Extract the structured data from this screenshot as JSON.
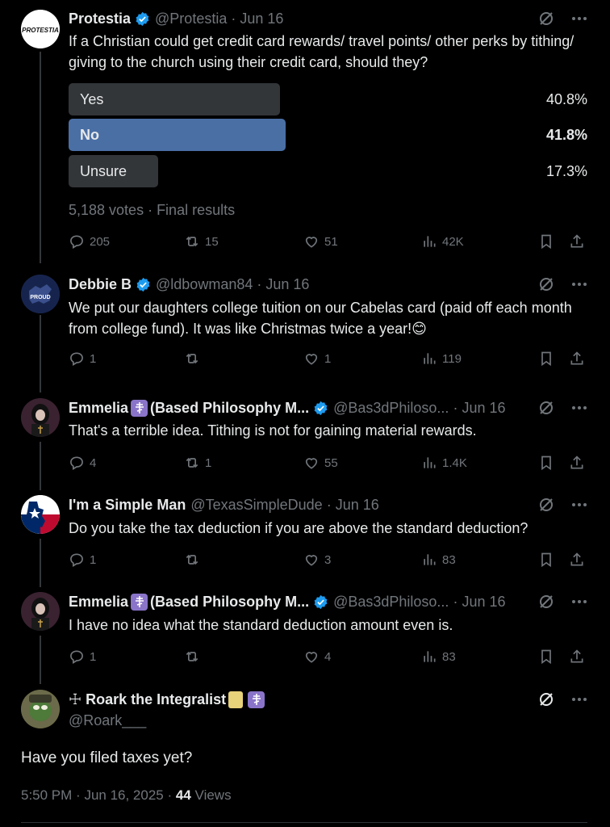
{
  "post1": {
    "name": "Protestia",
    "handle": "@Protestia",
    "date": "Jun 16",
    "avatar_text": "PROTESTIA",
    "text": "If a Christian could get credit card rewards/ travel points/ other perks by tithing/ giving to the church using their credit card, should they?",
    "poll": {
      "options": [
        {
          "label": "Yes",
          "percent": "40.8%",
          "value": 40.8
        },
        {
          "label": "No",
          "percent": "41.8%",
          "value": 41.8
        },
        {
          "label": "Unsure",
          "percent": "17.3%",
          "value": 17.3
        }
      ],
      "summary": "5,188 votes · Final results"
    },
    "replies": "205",
    "reposts": "15",
    "likes": "51",
    "views": "42K"
  },
  "post2": {
    "name": "Debbie B",
    "handle": "@ldbowman84",
    "date": "Jun 16",
    "avatar_text": "PROUD",
    "text": "We put our daughters college tuition on our Cabelas card (paid off each month from college fund). It was like Christmas twice a year!😊",
    "replies": "1",
    "reposts": "",
    "likes": "1",
    "views": "119"
  },
  "post3": {
    "name": "Emmelia",
    "name_suffix": "(Based Philosophy M...",
    "handle": "@Bas3dPhiloso...",
    "date": "Jun 16",
    "text": "That's a terrible idea. Tithing is not for gaining material rewards.",
    "replies": "4",
    "reposts": "1",
    "likes": "55",
    "views": "1.4K"
  },
  "post4": {
    "name": "I'm a Simple Man",
    "handle": "@TexasSimpleDude",
    "date": "Jun 16",
    "text": "Do you take the tax deduction if you are above the standard deduction?",
    "replies": "1",
    "reposts": "",
    "likes": "3",
    "views": "83"
  },
  "post5": {
    "name": "Emmelia",
    "name_suffix": "(Based Philosophy M...",
    "handle": "@Bas3dPhiloso...",
    "date": "Jun 16",
    "text": "I have no idea what the standard deduction amount even is.",
    "replies": "1",
    "reposts": "",
    "likes": "4",
    "views": "83"
  },
  "post6": {
    "name": "☩ Roark the Integralist",
    "handle": "@Roark___",
    "text": "Have you filed taxes yet?",
    "time": "5:50 PM",
    "date": "Jun 16, 2025",
    "views_count": "44",
    "views_label": "Views"
  },
  "colors": {
    "background": "#000000",
    "text": "#e7e9ea",
    "muted": "#71767b",
    "poll_winner": "#4a6fa5",
    "poll_bar": "#333639",
    "verified": "#1d9bf0",
    "badge": "#8a74c9"
  }
}
